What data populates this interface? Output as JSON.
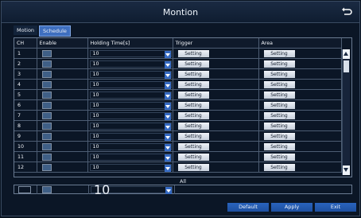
{
  "window": {
    "title": "Montion"
  },
  "tabs": [
    {
      "label": "Motion",
      "active": false
    },
    {
      "label": "Schedule",
      "active": true
    }
  ],
  "table": {
    "columns": [
      "CH",
      "Enable",
      "Holding Time[s]",
      "Trigger",
      "Area"
    ],
    "rows": [
      {
        "ch": "1",
        "holding": "10",
        "trigger": "Setting",
        "area": "Setting"
      },
      {
        "ch": "2",
        "holding": "10",
        "trigger": "Setting",
        "area": "Setting"
      },
      {
        "ch": "3",
        "holding": "10",
        "trigger": "Setting",
        "area": "Setting"
      },
      {
        "ch": "4",
        "holding": "10",
        "trigger": "Setting",
        "area": "Setting"
      },
      {
        "ch": "5",
        "holding": "10",
        "trigger": "Setting",
        "area": "Setting"
      },
      {
        "ch": "6",
        "holding": "10",
        "trigger": "Setting",
        "area": "Setting"
      },
      {
        "ch": "7",
        "holding": "10",
        "trigger": "Setting",
        "area": "Setting"
      },
      {
        "ch": "8",
        "holding": "10",
        "trigger": "Setting",
        "area": "Setting"
      },
      {
        "ch": "9",
        "holding": "10",
        "trigger": "Setting",
        "area": "Setting"
      },
      {
        "ch": "10",
        "holding": "10",
        "trigger": "Setting",
        "area": "Setting"
      },
      {
        "ch": "11",
        "holding": "10",
        "trigger": "Setting",
        "area": "Setting"
      },
      {
        "ch": "12",
        "holding": "10",
        "trigger": "Setting",
        "area": "Setting"
      }
    ]
  },
  "all": {
    "label": "All",
    "holding": "10"
  },
  "buttons": {
    "default": "Default",
    "apply": "Apply",
    "exit": "Exit"
  },
  "icons": {
    "back": "back-arrow-icon"
  },
  "colors": {
    "accent": "#3f6fbf",
    "button": "#2a64be",
    "background": "#0b1626"
  }
}
